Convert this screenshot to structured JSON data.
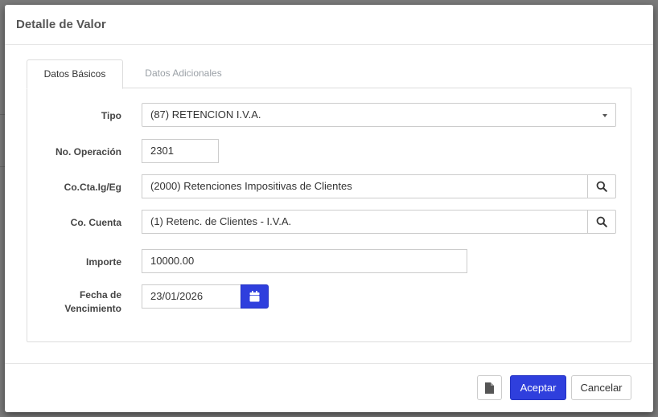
{
  "modal": {
    "title": "Detalle de Valor"
  },
  "tabs": [
    {
      "label": "Datos Básicos",
      "active": true
    },
    {
      "label": "Datos Adicionales",
      "active": false
    }
  ],
  "form": {
    "tipo": {
      "label": "Tipo",
      "value": "(87) RETENCION I.V.A."
    },
    "operacion": {
      "label": "No. Operación",
      "value": "2301"
    },
    "cta_ig_eg": {
      "label": "Co.Cta.Ig/Eg",
      "value": "(2000) Retenciones Impositivas de Clientes"
    },
    "cuenta": {
      "label": "Co. Cuenta",
      "value": "(1) Retenc. de Clientes - I.V.A."
    },
    "importe": {
      "label": "Importe",
      "value": "10000.00"
    },
    "vencimiento": {
      "label_line1": "Fecha de",
      "label_line2": "Vencimiento",
      "value": "23/01/2026"
    }
  },
  "footer": {
    "accept_label": "Aceptar",
    "cancel_label": "Cancelar"
  },
  "icons": {
    "search": "search-icon",
    "calendar": "calendar-icon",
    "document": "document-icon"
  },
  "colors": {
    "primary": "#2f3fdd"
  }
}
